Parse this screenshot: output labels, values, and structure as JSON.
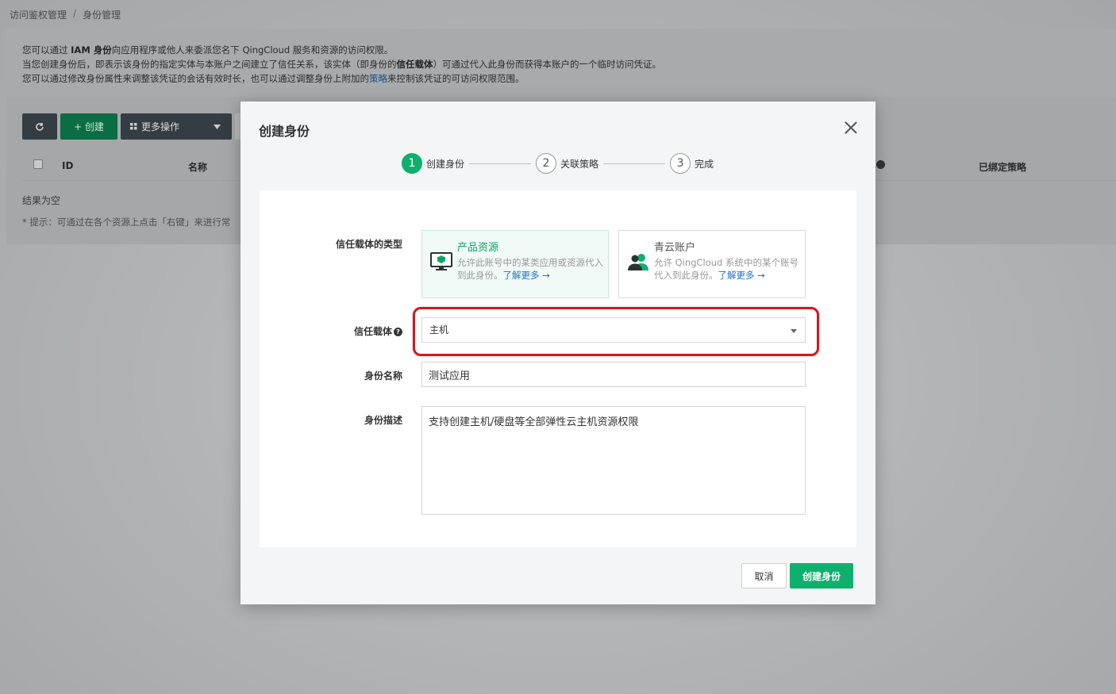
{
  "breadcrumb": [
    "访问鉴权管理",
    "身份管理"
  ],
  "breadcrumb_sep": "/",
  "info": {
    "line1_a": "您可以通过",
    "line1_b": "IAM 身份",
    "line1_c": "向应用程序或他人来委派您名下 QingCloud 服务和资源的访问权限。",
    "line2_a": "当您创建身份后，即表示该身份的指定实体与本账户之间建立了信任关系，该实体（即身份的",
    "line2_b": "信任载体",
    "line2_c": "）可通过代入此身份而获得本账户的一个临时访问凭证。",
    "line3_a": "您可以通过修改身份属性来调整该凭证的会话有效时长，也可以通过调整身份上附加的",
    "line3_link": "策略",
    "line3_c": "来控制该凭证的可访问权限范围。"
  },
  "toolbar": {
    "create": "+ 创建",
    "more": "更多操作"
  },
  "table": {
    "col_id": "ID",
    "col_name": "名称",
    "col_policy": "已绑定策略"
  },
  "empty_text": "结果为空",
  "hint_text": "* 提示：可通过在各个资源上点击「右键」来进行常",
  "modal": {
    "title": "创建身份",
    "steps": [
      {
        "num": "1",
        "label": "创建身份"
      },
      {
        "num": "2",
        "label": "关联策略"
      },
      {
        "num": "3",
        "label": "完成"
      }
    ],
    "trust_type_label": "信任载体的类型",
    "cards": [
      {
        "title": "产品资源",
        "desc": "允许此账号中的某类应用或资源代入到此身份。",
        "link": "了解更多 →"
      },
      {
        "title": "青云账户",
        "desc": "允许 QingCloud 系统中的某个账号代入到此身份。",
        "link": "了解更多 →"
      }
    ],
    "trust_label": "信任载体",
    "trust_value": "主机",
    "name_label": "身份名称",
    "name_value": "测试应用",
    "desc_label": "身份描述",
    "desc_value": "支持创建主机/硬盘等全部弹性云主机资源权限",
    "cancel": "取消",
    "submit": "创建身份"
  },
  "colors": {
    "primary": "#0eb06e",
    "highlight": "#d4181c",
    "link": "#1f6fd1"
  }
}
